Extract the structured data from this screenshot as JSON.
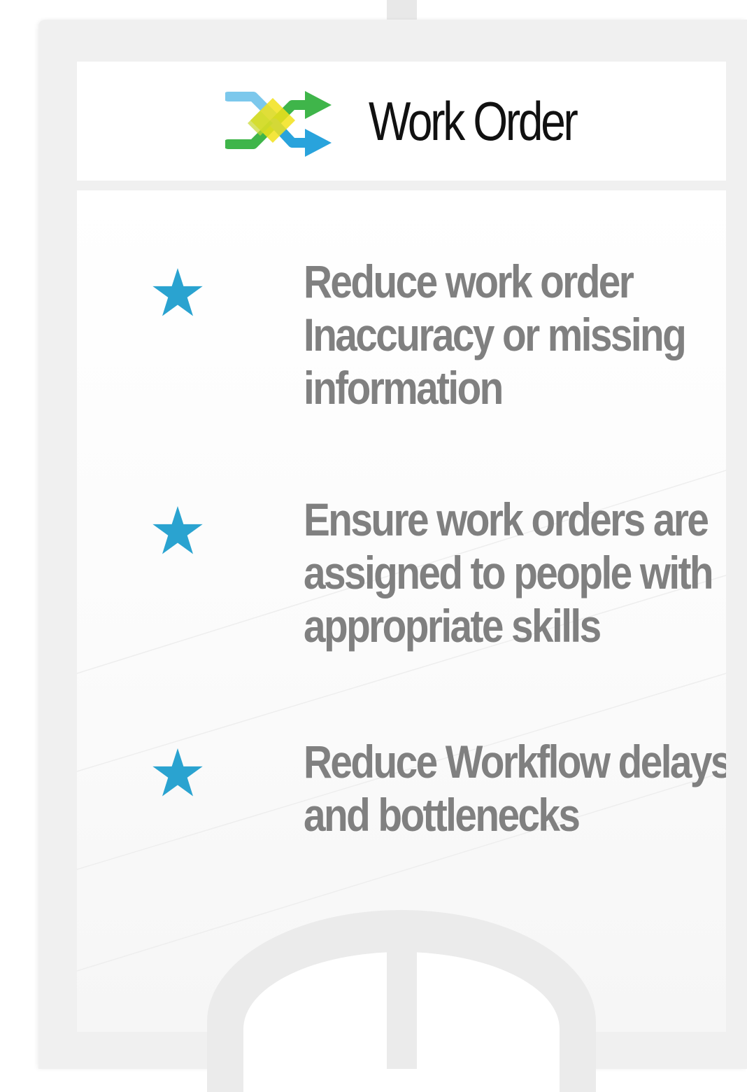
{
  "header": {
    "title": "Work Order",
    "logo_icon": "shuffle-arrows-icon",
    "logo_colors": {
      "green": "#3fb54a",
      "blue": "#29a3dc",
      "light_blue": "#7cc8ec",
      "yellow": "#f2e21a"
    }
  },
  "bullets": [
    {
      "icon": "star-icon",
      "lines": [
        "Reduce work order",
        "Inaccuracy or missing",
        "information"
      ]
    },
    {
      "icon": "star-icon",
      "lines": [
        "Ensure work orders are",
        "assigned to people with",
        "appropriate skills"
      ]
    },
    {
      "icon": "star-icon",
      "lines": [
        "Reduce Workflow delays",
        "and bottlenecks"
      ]
    }
  ],
  "colors": {
    "star": "#2aa3d0",
    "bullet_text": "#808080",
    "title_text": "#111111",
    "frame": "#f0f0f0"
  }
}
